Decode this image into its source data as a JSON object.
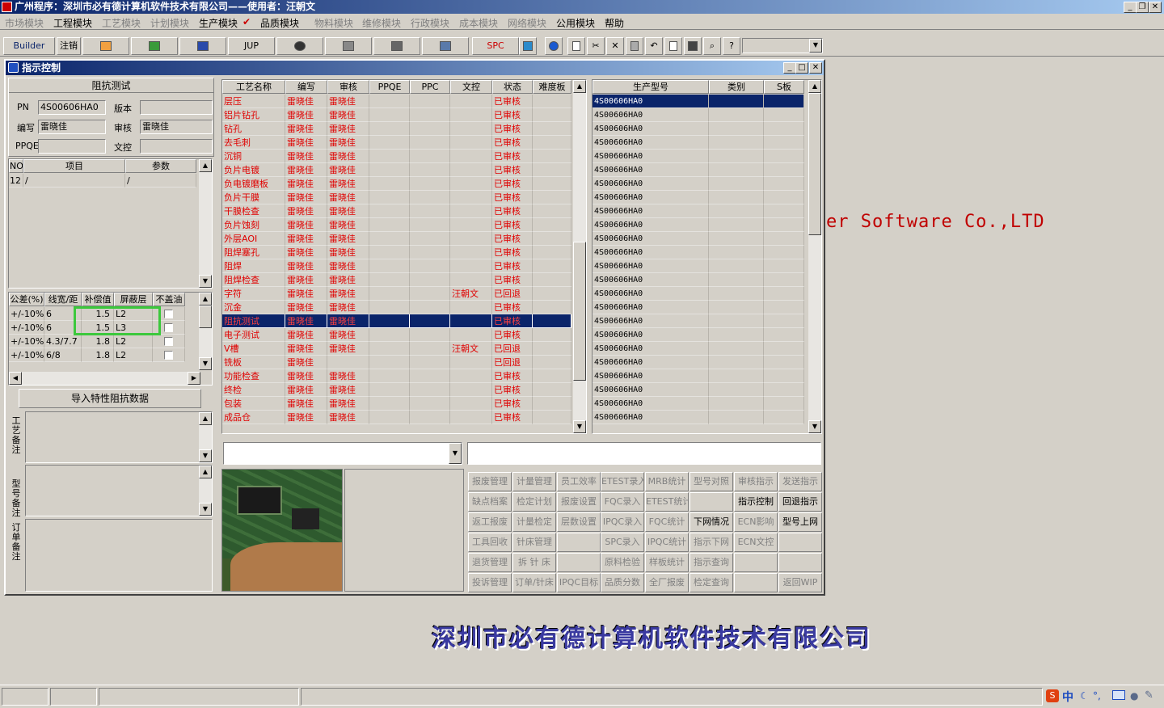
{
  "app": {
    "title": "广州程序：深圳市必有德计算机软件技术有限公司——使用者：汪朝文",
    "title_buttons": [
      "_",
      "❐",
      "✕"
    ]
  },
  "menu": [
    {
      "label": "市场模块",
      "enabled": false
    },
    {
      "label": "工程模块",
      "enabled": true
    },
    {
      "label": "工艺模块",
      "enabled": false
    },
    {
      "label": "计划模块",
      "enabled": false
    },
    {
      "label": "生产模块",
      "enabled": true
    },
    {
      "label": "品质模块",
      "enabled": true
    },
    {
      "label": "物料模块",
      "enabled": false
    },
    {
      "label": "维修模块",
      "enabled": false
    },
    {
      "label": "行政模块",
      "enabled": false
    },
    {
      "label": "成本模块",
      "enabled": false
    },
    {
      "label": "网络模块",
      "enabled": false
    },
    {
      "label": "公用模块",
      "enabled": true
    },
    {
      "label": "帮助",
      "enabled": true
    }
  ],
  "toolbar": {
    "builder": "Builder",
    "logout": "注销",
    "jup": "JUP",
    "spc": "SPC"
  },
  "background": {
    "slogan": "er Software Co.,LTD",
    "company": "深圳市必有德计算机软件技术有限公司"
  },
  "window": {
    "title": "指示控制",
    "buttons": [
      "_",
      "□",
      "✕"
    ]
  },
  "impedance": {
    "section_title": "阻抗测试",
    "pn_label": "PN",
    "pn_value": "4S00606HA0",
    "version_label": "版本",
    "version_value": "",
    "author_label": "编写",
    "author_value": "雷晓佳",
    "review_label": "审核",
    "review_value": "雷晓佳",
    "ppqe_label": "PPQE",
    "ppqe_value": "",
    "doc_label": "文控",
    "doc_value": "",
    "items_headers": [
      "NO",
      "项目",
      "参数"
    ],
    "items_rows": [
      [
        "12",
        "/",
        "/"
      ]
    ],
    "tol_headers": [
      "公差(%)",
      "线宽/距",
      "补偿值",
      "屏蔽层",
      "不盖油"
    ],
    "tol_rows": [
      [
        "+/-10%",
        "6",
        "1.5",
        "L2"
      ],
      [
        "+/-10%",
        "6",
        "1.5",
        "L3"
      ],
      [
        "+/-10%",
        "4.3/7.7",
        "1.8",
        "L2"
      ],
      [
        "+/-10%",
        "6/8",
        "1.8",
        "L2"
      ]
    ],
    "import_button": "导入特性阻抗数据",
    "note_labels": [
      "工艺备注",
      "型号备注",
      "订单备注"
    ]
  },
  "process_grid": {
    "headers": [
      "工艺名称",
      "编写",
      "审核",
      "PPQE",
      "PPC",
      "文控",
      "状态",
      "难度板"
    ],
    "rows": [
      [
        "层压",
        "雷晓佳",
        "雷晓佳",
        "",
        "",
        "",
        "已审核"
      ],
      [
        "铝片钻孔",
        "雷晓佳",
        "雷晓佳",
        "",
        "",
        "",
        "已审核"
      ],
      [
        "钻孔",
        "雷晓佳",
        "雷晓佳",
        "",
        "",
        "",
        "已审核"
      ],
      [
        "去毛刺",
        "雷晓佳",
        "雷晓佳",
        "",
        "",
        "",
        "已审核"
      ],
      [
        "沉铜",
        "雷晓佳",
        "雷晓佳",
        "",
        "",
        "",
        "已审核"
      ],
      [
        "负片电镀",
        "雷晓佳",
        "雷晓佳",
        "",
        "",
        "",
        "已审核"
      ],
      [
        "负电镀磨板",
        "雷晓佳",
        "雷晓佳",
        "",
        "",
        "",
        "已审核"
      ],
      [
        "负片干膜",
        "雷晓佳",
        "雷晓佳",
        "",
        "",
        "",
        "已审核"
      ],
      [
        "干膜检查",
        "雷晓佳",
        "雷晓佳",
        "",
        "",
        "",
        "已审核"
      ],
      [
        "负片蚀刻",
        "雷晓佳",
        "雷晓佳",
        "",
        "",
        "",
        "已审核"
      ],
      [
        "外层AOI",
        "雷晓佳",
        "雷晓佳",
        "",
        "",
        "",
        "已审核"
      ],
      [
        "阻焊塞孔",
        "雷晓佳",
        "雷晓佳",
        "",
        "",
        "",
        "已审核"
      ],
      [
        "阻焊",
        "雷晓佳",
        "雷晓佳",
        "",
        "",
        "",
        "已审核"
      ],
      [
        "阻焊检查",
        "雷晓佳",
        "雷晓佳",
        "",
        "",
        "",
        "已审核"
      ],
      [
        "字符",
        "雷晓佳",
        "雷晓佳",
        "",
        "",
        "汪朝文",
        "已回退"
      ],
      [
        "沉金",
        "雷晓佳",
        "雷晓佳",
        "",
        "",
        "",
        "已审核"
      ],
      [
        "阻抗测试",
        "雷晓佳",
        "雷晓佳",
        "",
        "",
        "",
        "已审核"
      ],
      [
        "电子测试",
        "雷晓佳",
        "雷晓佳",
        "",
        "",
        "",
        "已审核"
      ],
      [
        "V槽",
        "雷晓佳",
        "雷晓佳",
        "",
        "",
        "汪朝文",
        "已回退"
      ],
      [
        "铣板",
        "雷晓佳",
        "",
        "",
        "",
        "",
        "已回退"
      ],
      [
        "功能检查",
        "雷晓佳",
        "雷晓佳",
        "",
        "",
        "",
        "已审核"
      ],
      [
        "终检",
        "雷晓佳",
        "雷晓佳",
        "",
        "",
        "",
        "已审核"
      ],
      [
        "包装",
        "雷晓佳",
        "雷晓佳",
        "",
        "",
        "",
        "已审核"
      ],
      [
        "成品仓",
        "雷晓佳",
        "雷晓佳",
        "",
        "",
        "",
        "已审核"
      ]
    ],
    "selected_index": 16
  },
  "model_grid": {
    "headers": [
      "生产型号",
      "类别",
      "S板"
    ],
    "rows": [
      "4S00606HA0",
      "4S00606HA0",
      "4S00606HA0",
      "4S00606HA0",
      "4S00606HA0",
      "4S00606HA0",
      "4S00606HA0",
      "4S00606HA0",
      "4S00606HA0",
      "4S00606HA0",
      "4S00606HA0",
      "4S00606HA0",
      "4S00606HA0",
      "4S00606HA0",
      "4S00606HA0",
      "4S00606HA0",
      "4S00606HA0",
      "4S00606HA0",
      "4S00606HA0",
      "4S00606HA0",
      "4S00606HA0",
      "4S00606HA0",
      "4S00606HA0",
      "4S00606HA0"
    ],
    "selected_index": 0
  },
  "function_buttons": [
    [
      {
        "l": "报废管理",
        "e": false
      },
      {
        "l": "计量管理",
        "e": false
      },
      {
        "l": "员工效率",
        "e": false
      },
      {
        "l": "ETEST录入",
        "e": false
      },
      {
        "l": "MRB统计",
        "e": false
      },
      {
        "l": "型号对照",
        "e": false
      },
      {
        "l": "审核指示",
        "e": false
      },
      {
        "l": "发送指示",
        "e": false
      }
    ],
    [
      {
        "l": "缺点档案",
        "e": false
      },
      {
        "l": "检定计划",
        "e": false
      },
      {
        "l": "报废设置",
        "e": false
      },
      {
        "l": "FQC录入",
        "e": false
      },
      {
        "l": "ETEST统计",
        "e": false
      },
      {
        "l": "",
        "e": false
      },
      {
        "l": "指示控制",
        "e": true
      },
      {
        "l": "回退指示",
        "e": true
      }
    ],
    [
      {
        "l": "返工报废",
        "e": false
      },
      {
        "l": "计量检定",
        "e": false
      },
      {
        "l": "层数设置",
        "e": false
      },
      {
        "l": "IPQC录入",
        "e": false
      },
      {
        "l": "FQC统计",
        "e": false
      },
      {
        "l": "下网情况",
        "e": true
      },
      {
        "l": "ECN影响",
        "e": false
      },
      {
        "l": "型号上网",
        "e": true
      }
    ],
    [
      {
        "l": "工具回收",
        "e": false
      },
      {
        "l": "针床管理",
        "e": false
      },
      {
        "l": "",
        "e": false
      },
      {
        "l": "SPC录入",
        "e": false
      },
      {
        "l": "IPQC统计",
        "e": false
      },
      {
        "l": "指示下网",
        "e": false
      },
      {
        "l": "ECN文控",
        "e": false
      },
      {
        "l": "",
        "e": false
      }
    ],
    [
      {
        "l": "退货管理",
        "e": false
      },
      {
        "l": "拆 针 床",
        "e": false
      },
      {
        "l": "",
        "e": false
      },
      {
        "l": "原料检验",
        "e": false
      },
      {
        "l": "样板统计",
        "e": false
      },
      {
        "l": "指示查询",
        "e": false
      },
      {
        "l": "",
        "e": false
      },
      {
        "l": "",
        "e": false
      }
    ],
    [
      {
        "l": "投诉管理",
        "e": false
      },
      {
        "l": "订单/针床",
        "e": false
      },
      {
        "l": "IPQC目标",
        "e": false
      },
      {
        "l": "品质分数",
        "e": false
      },
      {
        "l": "全厂报废",
        "e": false
      },
      {
        "l": "检定查询",
        "e": false
      },
      {
        "l": "",
        "e": false
      },
      {
        "l": "返回WIP",
        "e": false
      }
    ]
  ],
  "tray": {
    "ime": "中"
  }
}
